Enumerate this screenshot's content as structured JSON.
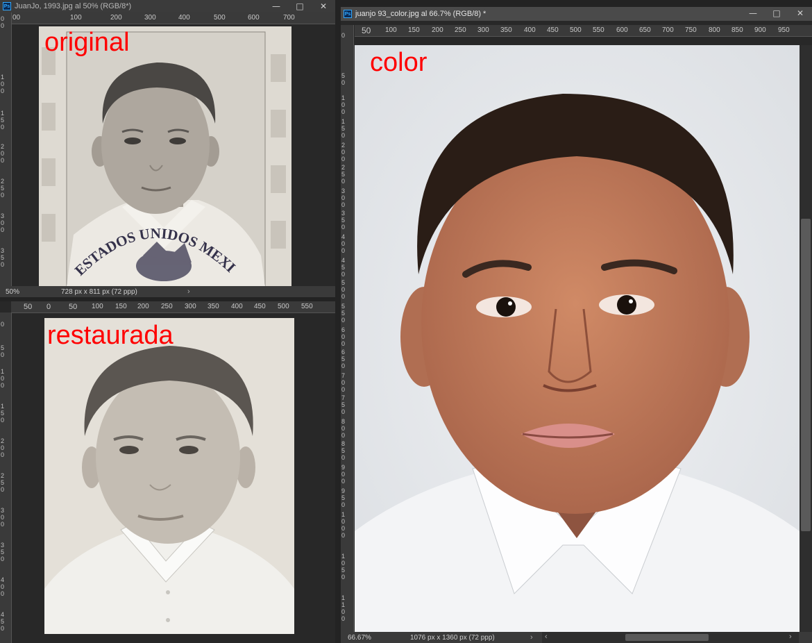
{
  "windows": {
    "original": {
      "title": "JuanJo, 1993.jpg al 50% (RGB/8*)",
      "overlay_label": "original",
      "zoom": "50%",
      "doc_info": "728 px x 811 px (72 ppp)",
      "ruler_h": [
        "00",
        "100",
        "200",
        "300",
        "400",
        "500",
        "600",
        "700"
      ],
      "stamp_text": "ESTADOS UNIDOS MEXICANOS"
    },
    "restored": {
      "overlay_label": "restaurada",
      "ruler_h": [
        "50",
        "0",
        "50",
        "100",
        "150",
        "200",
        "250",
        "300",
        "350",
        "400",
        "450",
        "500",
        "550"
      ]
    },
    "color": {
      "title": "juanjo 93_color.jpg al 66.7% (RGB/8) *",
      "overlay_label": "color",
      "zoom": "66.67%",
      "doc_info": "1076 px x 1360 px (72 ppp)",
      "ruler_h": [
        "50",
        "100",
        "150",
        "200",
        "250",
        "300",
        "350",
        "400",
        "450",
        "500",
        "550",
        "600",
        "650",
        "700",
        "750",
        "800",
        "850",
        "900",
        "950"
      ]
    }
  },
  "window_buttons": {
    "minimize": "—",
    "maximize": "□",
    "close": "✕"
  },
  "icons": {
    "app": "photoshop-icon",
    "chevron": "chevron-right-icon"
  },
  "colors": {
    "label_red": "#ff0000",
    "ui_dark": "#282828",
    "ruler": "#3a3a3a"
  }
}
